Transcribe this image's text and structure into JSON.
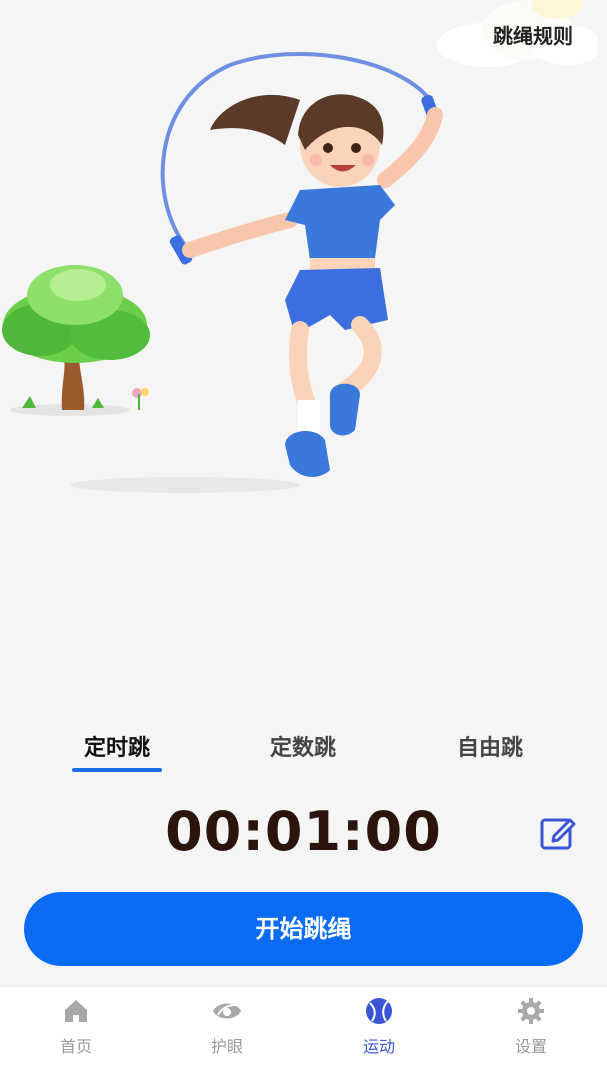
{
  "header": {
    "rules_label": "跳绳规则"
  },
  "illustration": {
    "subject": "girl-jumping-rope",
    "scenery": "tree-and-cloud"
  },
  "modes": {
    "tabs": [
      {
        "label": "定时跳",
        "active": true
      },
      {
        "label": "定数跳",
        "active": false
      },
      {
        "label": "自由跳",
        "active": false
      }
    ]
  },
  "timer": {
    "value": "00:01:00"
  },
  "action": {
    "start_label": "开始跳绳"
  },
  "bottom_nav": {
    "items": [
      {
        "label": "首页",
        "icon": "home-icon",
        "active": false
      },
      {
        "label": "护眼",
        "icon": "eye-care-icon",
        "active": false
      },
      {
        "label": "运动",
        "icon": "ball-icon",
        "active": true
      },
      {
        "label": "设置",
        "icon": "gear-icon",
        "active": false
      }
    ]
  },
  "colors": {
    "accent": "#0a6cf5",
    "active_nav": "#3b55d6",
    "timer": "#2a140c"
  }
}
